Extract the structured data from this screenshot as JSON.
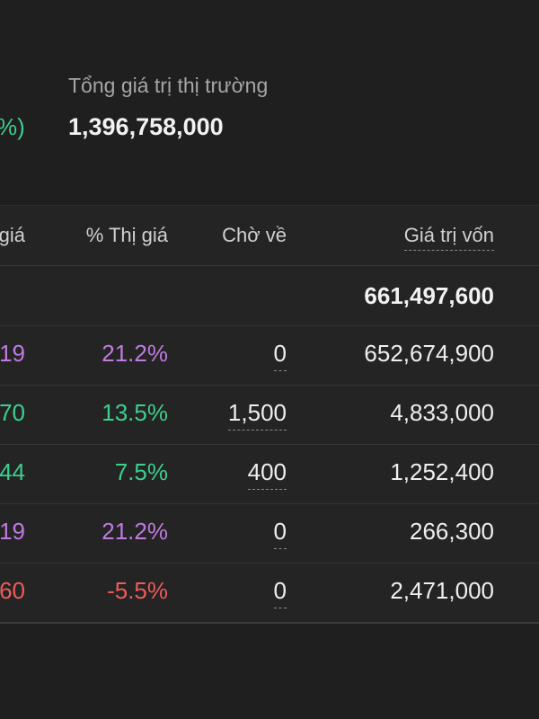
{
  "summary": {
    "partial_change": "%)",
    "market_value_label": "Tổng giá trị thị trường",
    "market_value": "1,396,758,000"
  },
  "table": {
    "headers": {
      "col_a": "giá",
      "col_b": "% Thị giá",
      "col_c": "Chờ về",
      "col_d": "Giá trị vốn"
    },
    "total_row": {
      "capital_value": "661,497,600"
    },
    "rows": [
      {
        "price_partial": "19",
        "market_pct": "21.2%",
        "pending": "0",
        "capital_value": "652,674,900",
        "color": "#c07ae0"
      },
      {
        "price_partial": "70",
        "market_pct": "13.5%",
        "pending": "1,500",
        "capital_value": "4,833,000",
        "color": "#3ccf8e"
      },
      {
        "price_partial": "44",
        "market_pct": "7.5%",
        "pending": "400",
        "capital_value": "1,252,400",
        "color": "#3ccf8e"
      },
      {
        "price_partial": "19",
        "market_pct": "21.2%",
        "pending": "0",
        "capital_value": "266,300",
        "color": "#c07ae0"
      },
      {
        "price_partial": "60",
        "market_pct": "-5.5%",
        "pending": "0",
        "capital_value": "2,471,000",
        "color": "#f05a5a"
      }
    ]
  }
}
